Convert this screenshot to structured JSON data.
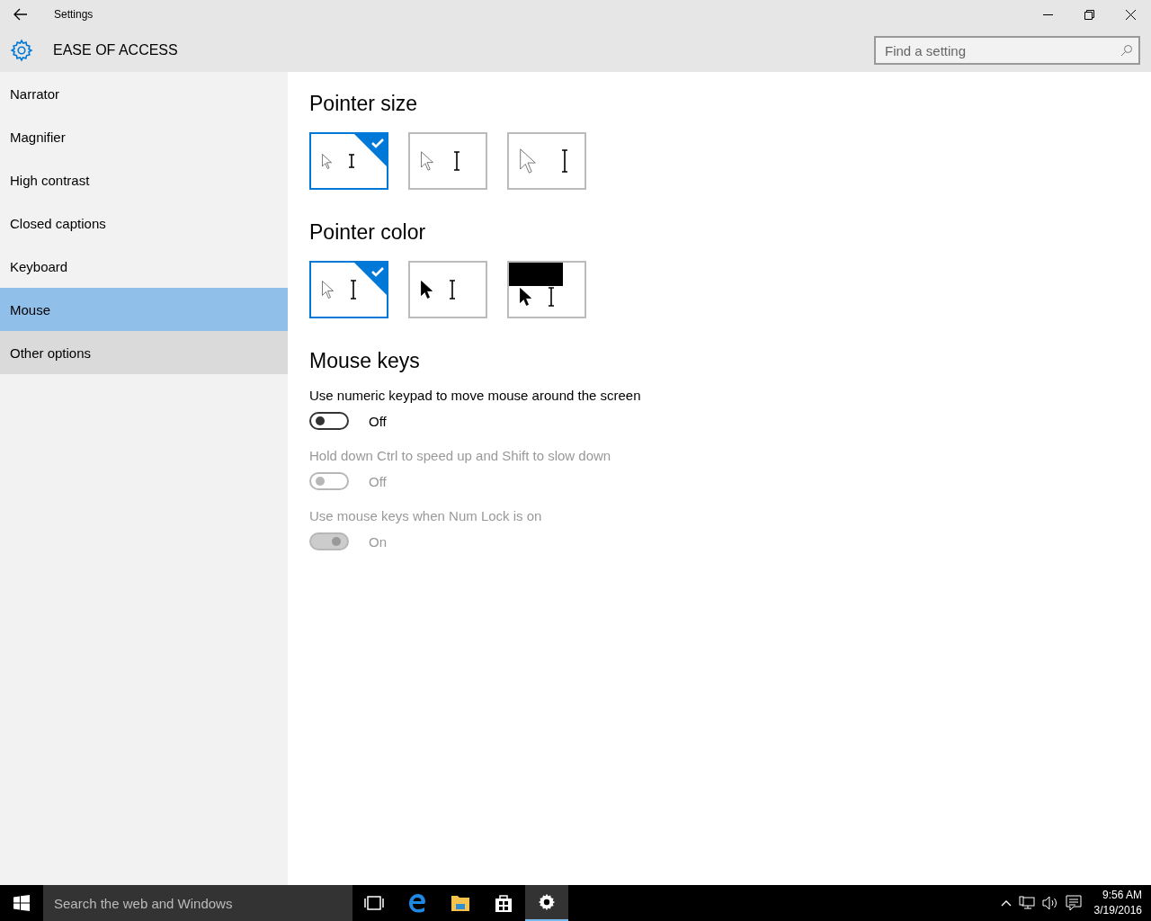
{
  "window": {
    "title": "Settings"
  },
  "header": {
    "title": "EASE OF ACCESS",
    "search": {
      "placeholder": "Find a setting"
    }
  },
  "sidebar": {
    "items": [
      {
        "label": "Narrator",
        "selected": false,
        "hovered": false
      },
      {
        "label": "Magnifier",
        "selected": false,
        "hovered": false
      },
      {
        "label": "High contrast",
        "selected": false,
        "hovered": false
      },
      {
        "label": "Closed captions",
        "selected": false,
        "hovered": false
      },
      {
        "label": "Keyboard",
        "selected": false,
        "hovered": false
      },
      {
        "label": "Mouse",
        "selected": true,
        "hovered": false
      },
      {
        "label": "Other options",
        "selected": false,
        "hovered": true
      }
    ]
  },
  "pointer_size": {
    "title": "Pointer size",
    "options": [
      {
        "kind": "small",
        "selected": true
      },
      {
        "kind": "medium",
        "selected": false
      },
      {
        "kind": "large",
        "selected": false
      }
    ]
  },
  "pointer_color": {
    "title": "Pointer color",
    "options": [
      {
        "kind": "white",
        "selected": true
      },
      {
        "kind": "black",
        "selected": false
      },
      {
        "kind": "inverted",
        "selected": false
      }
    ]
  },
  "mouse_keys": {
    "title": "Mouse keys",
    "settings": [
      {
        "label": "Use numeric keypad to move mouse around the screen",
        "on": false,
        "disabled": false,
        "state_text": "Off"
      },
      {
        "label": "Hold down Ctrl to speed up and Shift to slow down",
        "on": false,
        "disabled": true,
        "state_text": "Off"
      },
      {
        "label": "Use mouse keys when Num Lock is on",
        "on": true,
        "disabled": true,
        "state_text": "On"
      }
    ]
  },
  "taskbar": {
    "search": {
      "placeholder": "Search the web and Windows"
    },
    "apps": [
      {
        "kind": "task-view",
        "selected": false
      },
      {
        "kind": "edge",
        "selected": false
      },
      {
        "kind": "explorer",
        "selected": false
      },
      {
        "kind": "store",
        "selected": false
      },
      {
        "kind": "settings",
        "selected": true
      }
    ],
    "clock": {
      "time": "9:56 AM",
      "date": "3/19/2016"
    }
  }
}
